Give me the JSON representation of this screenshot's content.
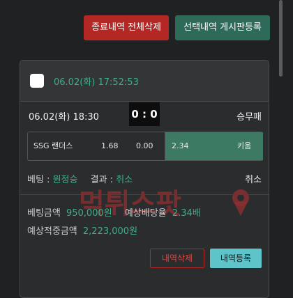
{
  "toolbar": {
    "delete_all_label": "종료내역 전체삭제",
    "post_selected_label": "선택내역 게시판등록"
  },
  "card": {
    "header_time": "06.02(화) 17:52:53",
    "match_date": "06.02(화) 18:30",
    "score": "0 : 0",
    "bet_type": "승무패",
    "odds": {
      "home_team": "SSG 랜더스",
      "home_odds": "1.68",
      "draw_odds": "0.00",
      "away_odds": "2.34",
      "away_team": "키움"
    },
    "bet_label": "베팅 :",
    "bet_value": "원정승",
    "result_label": "결과 :",
    "result_value": "취소",
    "status": "취소",
    "stake_label": "베팅금액",
    "stake_value": "950,000원",
    "expected_odds_label": "예상배당율",
    "expected_odds_value": "2.34배",
    "expected_win_label": "예상적중금액",
    "expected_win_value": "2,223,000원",
    "delete_label": "내역삭제",
    "register_label": "내역등록"
  },
  "watermark": "먹튀스팟",
  "colors": {
    "accent_green": "#3fae8a",
    "danger_red": "#b32824",
    "teal": "#5fc3ca",
    "selected_odds_bg": "#3c7a64"
  }
}
